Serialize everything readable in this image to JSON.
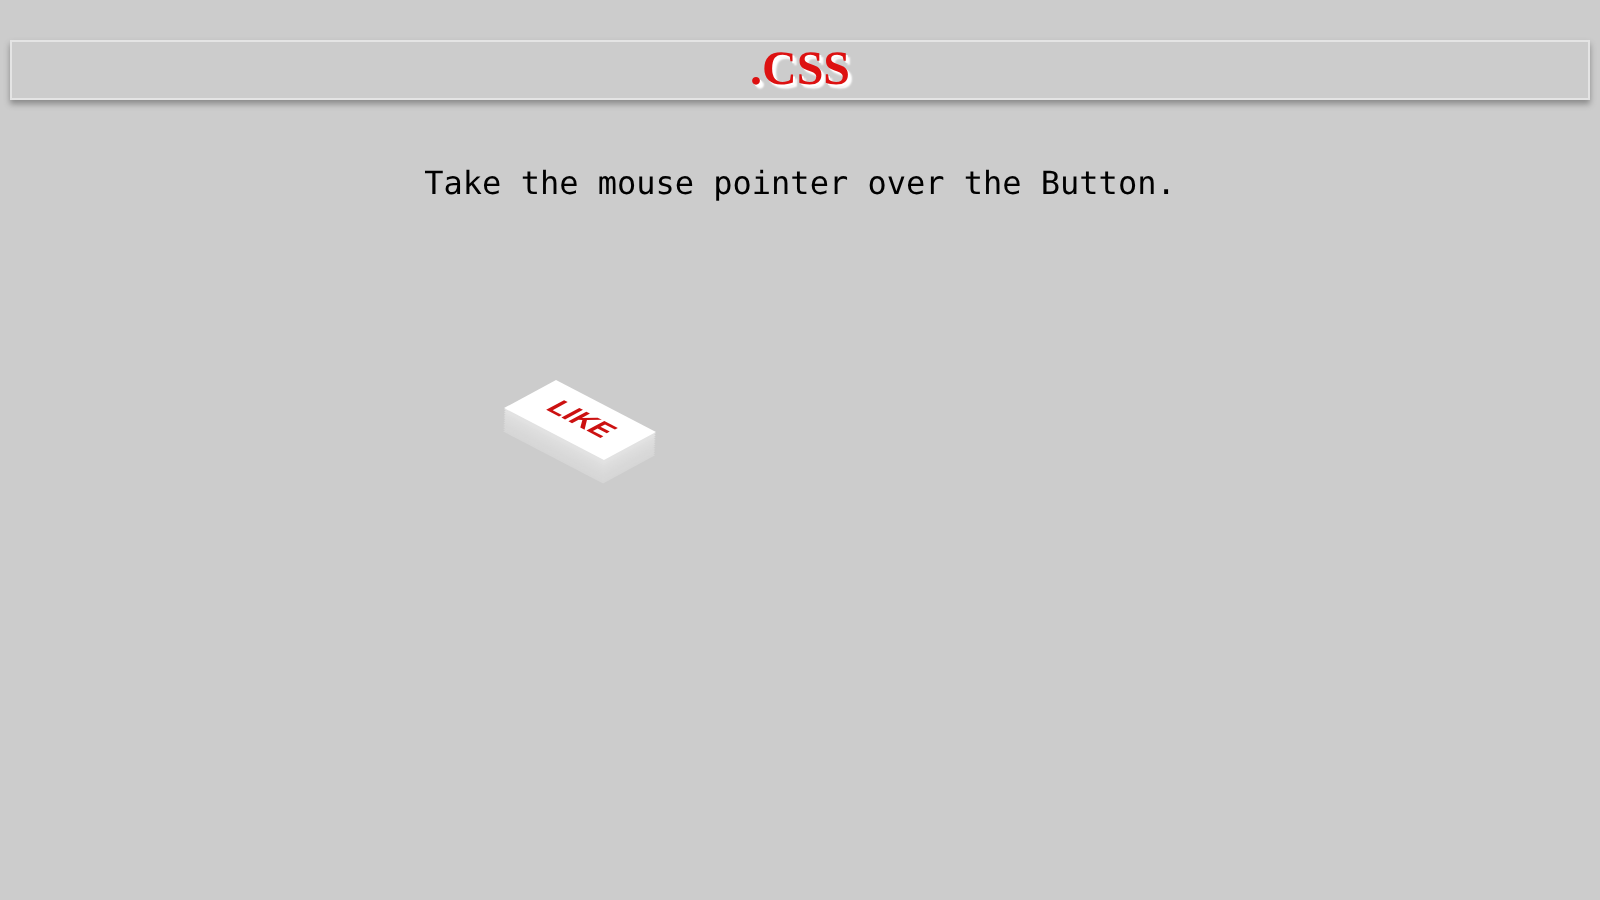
{
  "header": {
    "title": ".CSS"
  },
  "instruction": "Take the mouse pointer over the Button.",
  "button": {
    "label": "LIKE"
  }
}
